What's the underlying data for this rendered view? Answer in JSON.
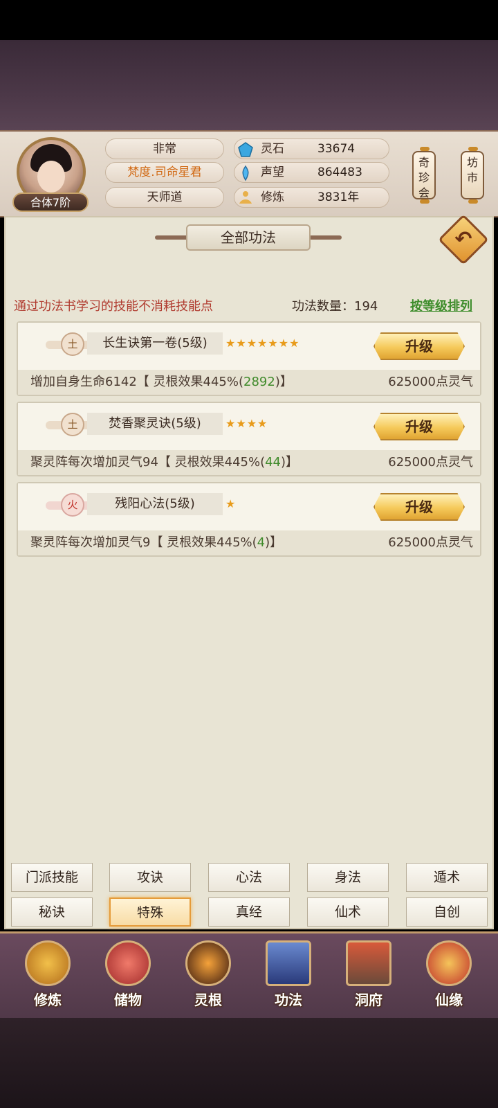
{
  "header": {
    "realm": "合体7阶",
    "status": "非常",
    "title": "梵度.司命星君",
    "sect": "天师道",
    "resources": [
      {
        "label": "灵石",
        "value": "33674",
        "icon": "spirit-stone-icon"
      },
      {
        "label": "声望",
        "value": "864483",
        "icon": "prestige-icon"
      },
      {
        "label": "修炼",
        "value": "3831年",
        "icon": "meditation-icon"
      }
    ],
    "shop1": "奇珍会",
    "shop2": "坊市"
  },
  "panel": {
    "title": "全部功法",
    "notice": "通过功法书学习的技能不消耗技能点",
    "count_label": "功法数量：194",
    "sort_label": "按等级排列"
  },
  "skills": [
    {
      "element": "土",
      "name": "长生诀第一卷(5级)",
      "stars": "★★★★★★★",
      "upgrade": "升级",
      "desc_pre": "增加自身生命6142【 灵根效果445%(",
      "desc_green": "2892",
      "desc_post": ")】",
      "cost": "625000点灵气"
    },
    {
      "element": "土",
      "name": "焚香聚灵诀(5级)",
      "stars": "★★★★",
      "upgrade": "升级",
      "desc_pre": "聚灵阵每次增加灵气94【 灵根效果445%(",
      "desc_green": "44",
      "desc_post": ")】",
      "cost": "625000点灵气"
    },
    {
      "element": "火",
      "name": "残阳心法(5级)",
      "stars": "★",
      "upgrade": "升级",
      "desc_pre": "聚灵阵每次增加灵气9【 灵根效果445%(",
      "desc_green": "4",
      "desc_post": ")】",
      "cost": "625000点灵气"
    }
  ],
  "tabs": [
    "门派技能",
    "攻诀",
    "心法",
    "身法",
    "遁术",
    "秘诀",
    "特殊",
    "真经",
    "仙术",
    "自创"
  ],
  "nav": [
    "修炼",
    "储物",
    "灵根",
    "功法",
    "洞府",
    "仙缘"
  ]
}
